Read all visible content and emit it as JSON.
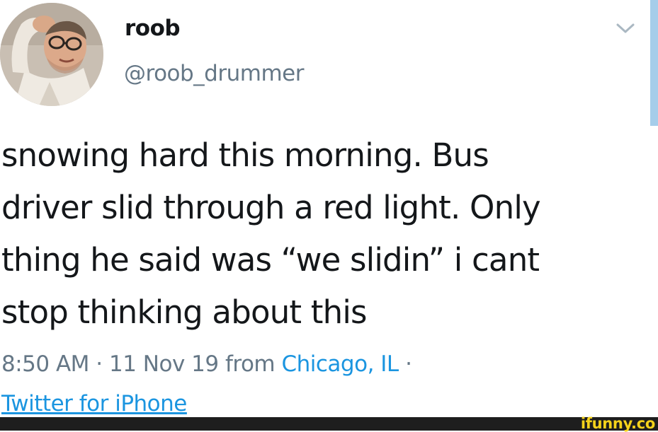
{
  "tweet": {
    "display_name": "roob",
    "handle": "@roob_drummer",
    "body_lines": [
      "snowing hard this morning. Bus",
      "driver slid through a red light. Only",
      "thing he said was “we slidin” i cant",
      "stop thinking about this"
    ],
    "time": "8:50 AM",
    "separator": "·",
    "date": "11 Nov 19",
    "from_label": "from",
    "location": "Chicago, IL",
    "source": "Twitter for iPhone"
  },
  "icons": {
    "menu_caret": "chevron-down-icon",
    "avatar": "profile-photo"
  },
  "watermark": {
    "text": "ifunny.co"
  },
  "colors": {
    "text_primary": "#14171a",
    "text_secondary": "#657786",
    "link": "#1b95e0",
    "watermark": "#f5d21b",
    "footer_background": "#1e1e1e"
  }
}
